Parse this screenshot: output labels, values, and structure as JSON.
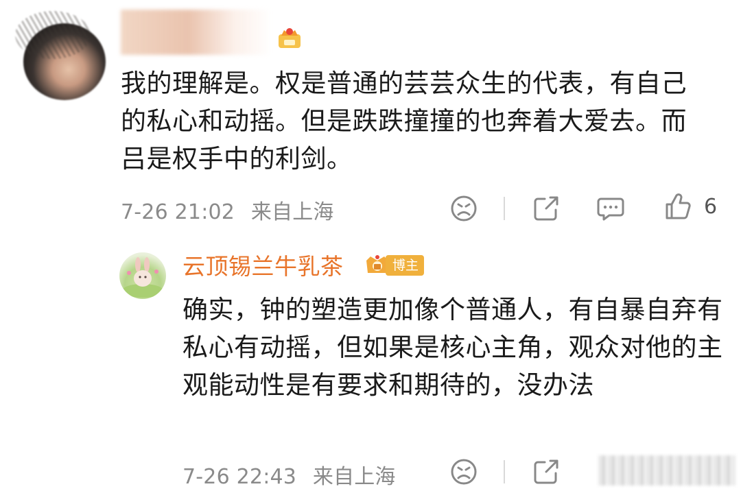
{
  "comment": {
    "text": "我的理解是。权是普通的芸芸众生的代表，有自己的私心和动摇。但是跌跌撞撞的也奔着大爱去。而吕是权手中的利剑。",
    "time": "7-26 21:02",
    "location": "来自上海",
    "like_count": "6",
    "icons": [
      "sad-face-icon",
      "share-icon",
      "comment-icon",
      "like-icon"
    ]
  },
  "reply": {
    "username": "云顶锡兰牛乳茶",
    "badge": "博主",
    "text": "确实，钟的塑造更加像个普通人，有自暴自弃有私心有动摇，但如果是核心主角，观众对他的主观能动性是有要求和期待的，没办法",
    "time": "7-26 22:43",
    "location": "来自上海",
    "icons": [
      "sad-face-icon",
      "share-icon"
    ]
  },
  "colors": {
    "username": "#e8742a",
    "meta": "#8a8a8a",
    "badge": "#f0b03c"
  }
}
